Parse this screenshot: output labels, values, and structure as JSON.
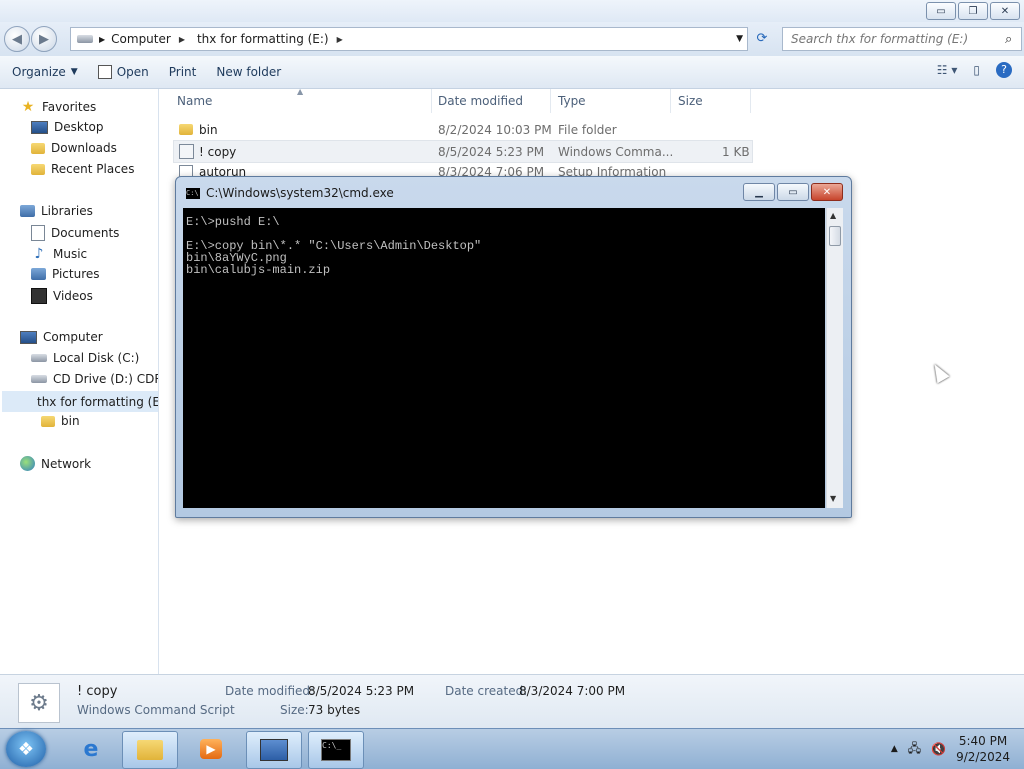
{
  "caption_buttons": {
    "minimize": "▭",
    "restore": "❐",
    "close": "✕"
  },
  "address": {
    "crumbs": [
      {
        "label": "Computer"
      },
      {
        "label": "thx for formatting (E:)"
      }
    ],
    "search_placeholder": "Search thx for formatting (E:)"
  },
  "toolbar": {
    "organize": "Organize",
    "open": "Open",
    "print": "Print",
    "new_folder": "New folder"
  },
  "sidebar": {
    "favorites": "Favorites",
    "desktop": "Desktop",
    "downloads": "Downloads",
    "recent": "Recent Places",
    "libraries": "Libraries",
    "documents": "Documents",
    "music": "Music",
    "pictures": "Pictures",
    "videos": "Videos",
    "computer": "Computer",
    "local_disk": "Local Disk (C:)",
    "cd_drive": "CD Drive (D:) CDROM",
    "thx_drive": "thx for formatting (E:)",
    "bin": "bin",
    "network": "Network"
  },
  "filelist": {
    "columns": {
      "name": "Name",
      "date": "Date modified",
      "type": "Type",
      "size": "Size"
    },
    "rows": [
      {
        "name": "bin",
        "date": "8/2/2024 10:03 PM",
        "type": "File folder",
        "size": ""
      },
      {
        "name": "! copy",
        "date": "8/5/2024 5:23 PM",
        "type": "Windows Comma...",
        "size": "1 KB"
      },
      {
        "name": "autorun",
        "date": "8/3/2024 7:06 PM",
        "type": "Setup Information",
        "size": ""
      }
    ]
  },
  "details": {
    "name": "! copy",
    "type": "Windows Command Script",
    "date_modified_label": "Date modified:",
    "date_modified": "8/5/2024 5:23 PM",
    "size_label": "Size:",
    "size": "73 bytes",
    "date_created_label": "Date created:",
    "date_created": "8/3/2024 7:00 PM"
  },
  "cmd": {
    "title": "C:\\Windows\\system32\\cmd.exe",
    "output": "E:\\>pushd E:\\\n\nE:\\>copy bin\\*.* \"C:\\Users\\Admin\\Desktop\"\nbin\\8aYWyC.png\nbin\\calubjs-main.zip"
  },
  "taskbar": {
    "time": "5:40 PM",
    "date": "9/2/2024"
  }
}
